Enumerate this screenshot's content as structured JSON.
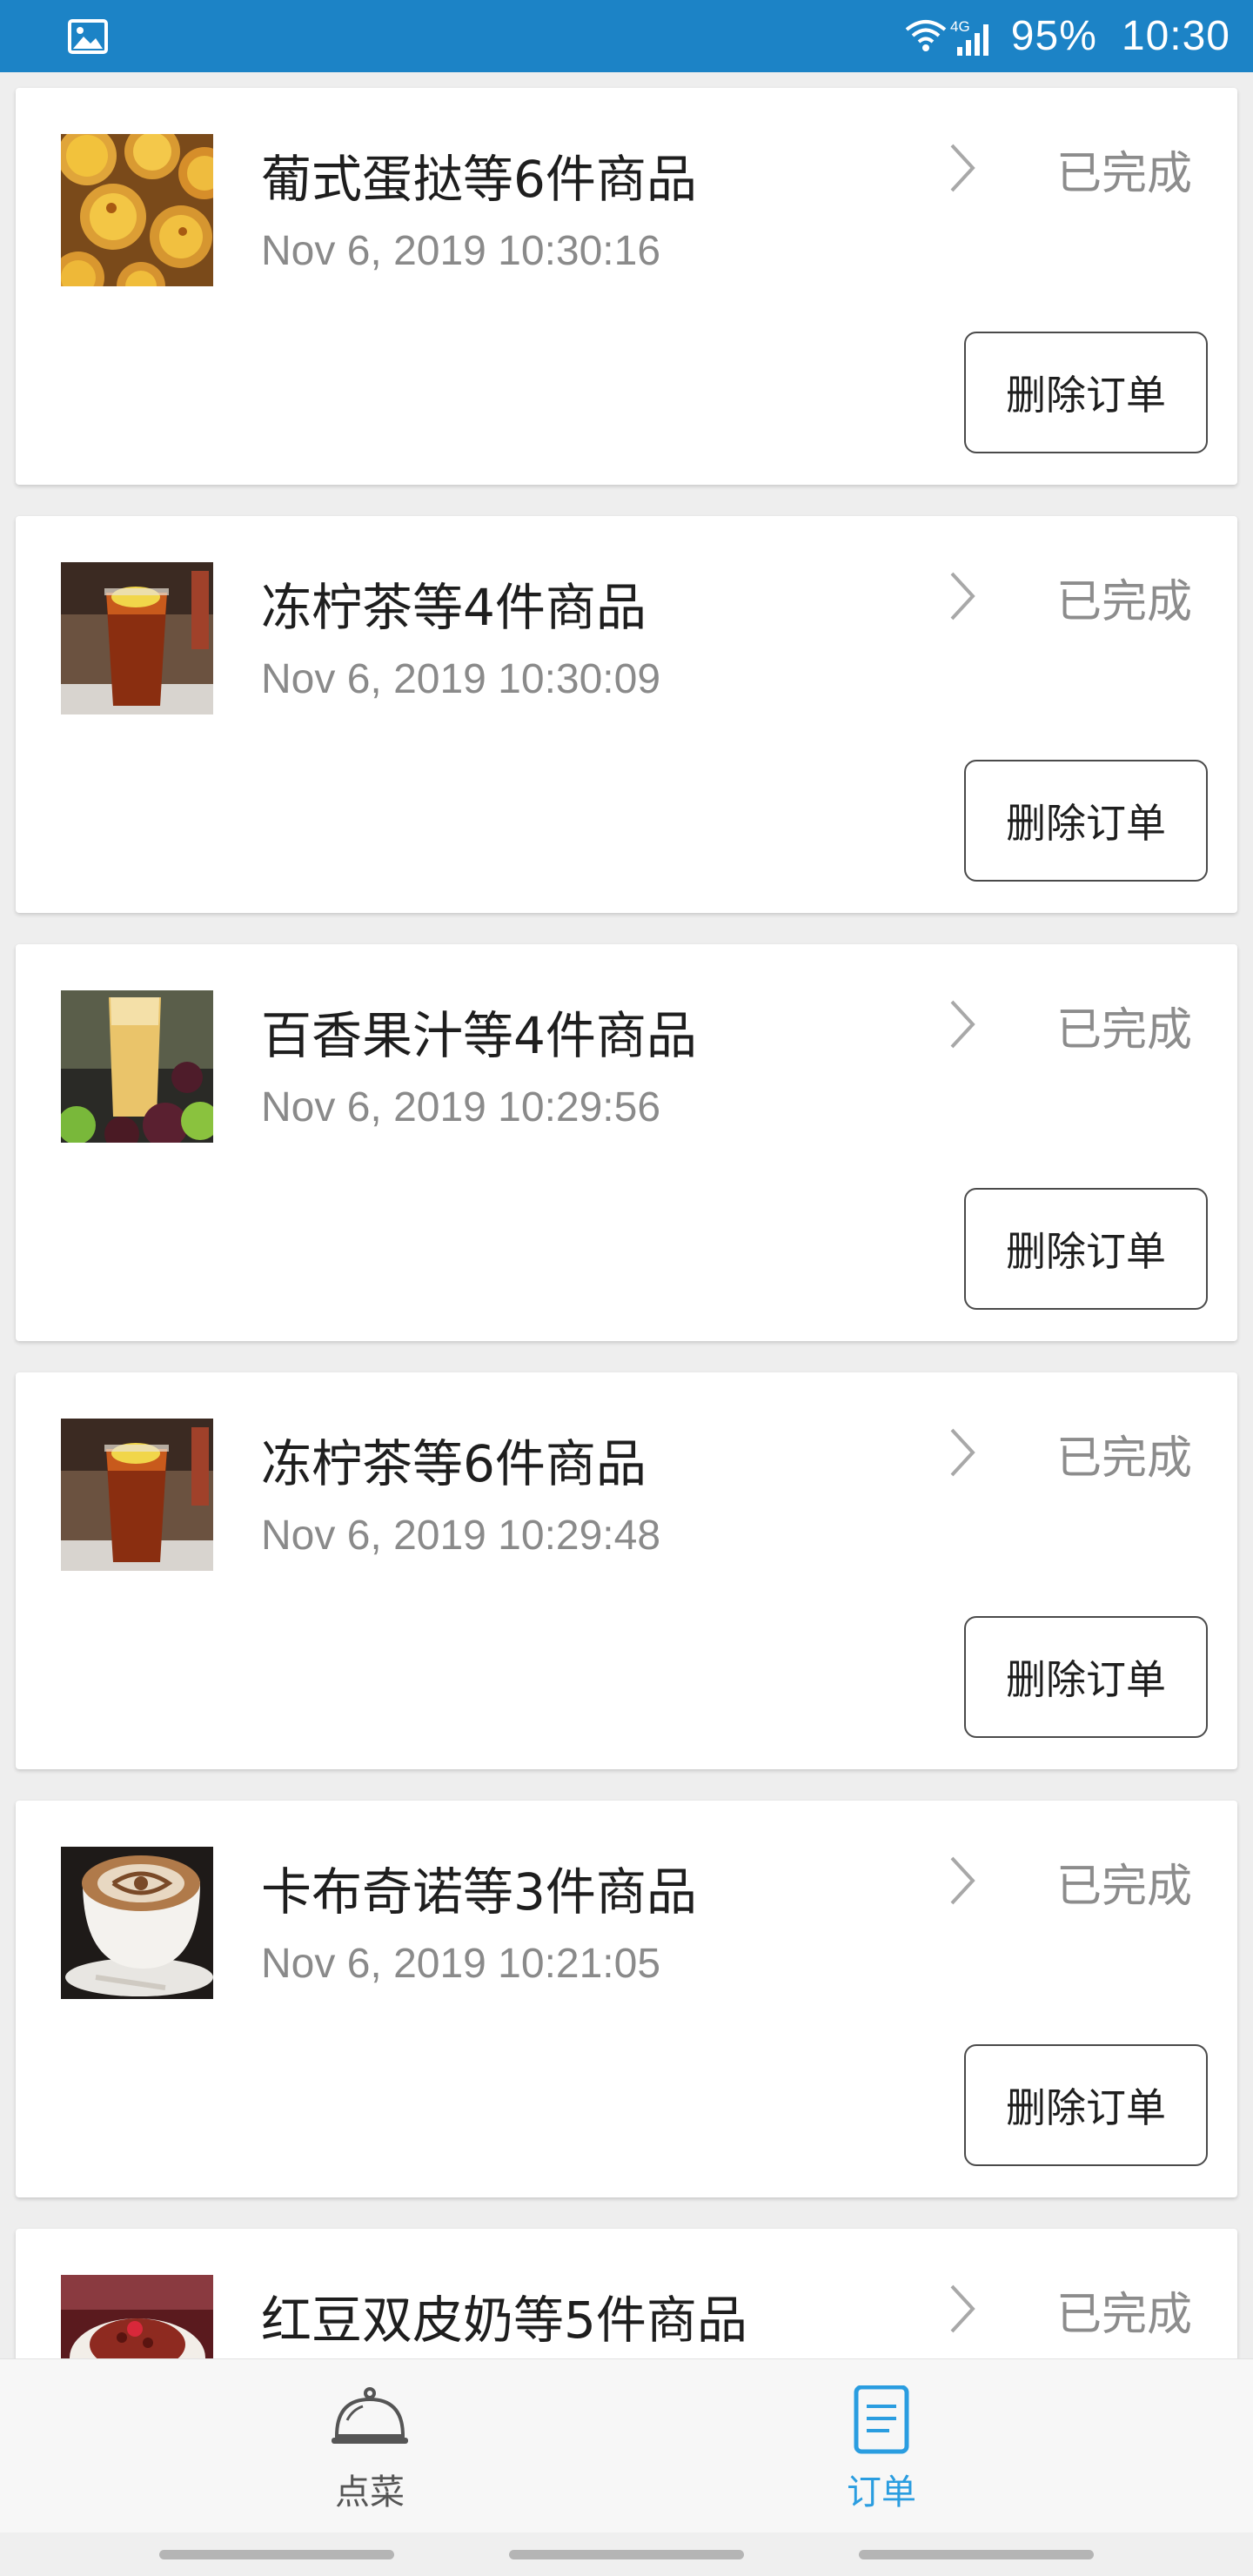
{
  "status_bar": {
    "battery": "95%",
    "time": "10:30",
    "network": "4G",
    "icons": [
      "image-icon",
      "wifi-icon",
      "signal-icon"
    ]
  },
  "orders": [
    {
      "title": "葡式蛋挞等6件商品",
      "time": "Nov 6, 2019 10:30:16",
      "status": "已完成",
      "delete_label": "删除订单",
      "thumb": "egg-tart-image"
    },
    {
      "title": "冻柠茶等4件商品",
      "time": "Nov 6, 2019 10:30:09",
      "status": "已完成",
      "delete_label": "删除订单",
      "thumb": "iced-lemon-tea-image"
    },
    {
      "title": "百香果汁等4件商品",
      "time": "Nov 6, 2019 10:29:56",
      "status": "已完成",
      "delete_label": "删除订单",
      "thumb": "passion-fruit-juice-image"
    },
    {
      "title": "冻柠茶等6件商品",
      "time": "Nov 6, 2019 10:29:48",
      "status": "已完成",
      "delete_label": "删除订单",
      "thumb": "iced-lemon-tea-image"
    },
    {
      "title": "卡布奇诺等3件商品",
      "time": "Nov 6, 2019 10:21:05",
      "status": "已完成",
      "delete_label": "删除订单",
      "thumb": "cappuccino-image"
    },
    {
      "title": "红豆双皮奶等5件商品",
      "status": "已完成",
      "thumb": "red-bean-pudding-image"
    }
  ],
  "bottom_nav": {
    "menu_label": "点菜",
    "orders_label": "订单",
    "active": "orders"
  },
  "colors": {
    "status_bar": "#1c83c6",
    "nav_active": "#2a9de0",
    "nav_inactive": "#555555"
  }
}
